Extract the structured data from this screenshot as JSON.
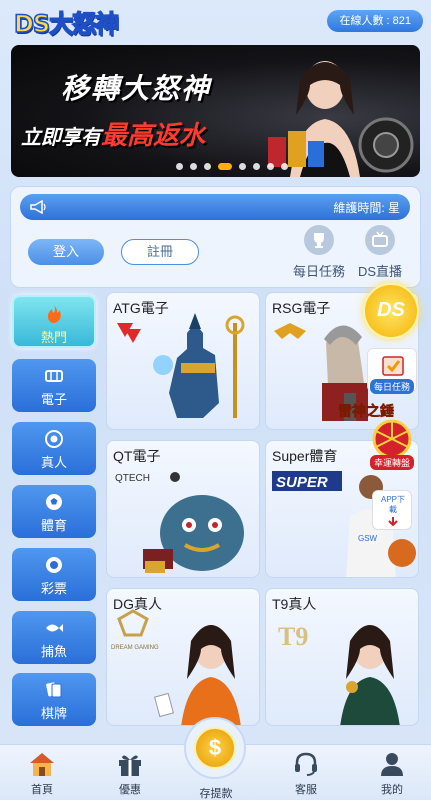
{
  "header": {
    "logo_text": "DS大怒神",
    "online_label": "在線人數 : 821"
  },
  "banner": {
    "line1": "移轉大怒神",
    "line2_prefix": "立即享有",
    "line2_highlight": "最高返水",
    "slide_count": 8,
    "active_slide": 3
  },
  "panel": {
    "marquee_text": "維護時間: 星",
    "login_label": "登入",
    "register_label": "註冊",
    "quick_links": [
      {
        "label": "每日任務",
        "icon": "trophy-icon"
      },
      {
        "label": "DS直播",
        "icon": "tv-icon"
      }
    ]
  },
  "sidebar": {
    "items": [
      {
        "label": "熱門",
        "icon": "fire-icon",
        "active": true
      },
      {
        "label": "電子",
        "icon": "slot-machine-icon",
        "active": false
      },
      {
        "label": "真人",
        "icon": "poker-chip-icon",
        "active": false
      },
      {
        "label": "體育",
        "icon": "soccer-ball-icon",
        "active": false
      },
      {
        "label": "彩票",
        "icon": "lottery-ball-icon",
        "active": false
      },
      {
        "label": "捕魚",
        "icon": "fish-icon",
        "active": false
      },
      {
        "label": "棋牌",
        "icon": "cards-icon",
        "active": false
      }
    ]
  },
  "games": [
    {
      "title": "ATG電子",
      "logo": "ATG"
    },
    {
      "title": "RSG電子",
      "logo": "RSG",
      "art_caption": "雷神之錘"
    },
    {
      "title": "QT電子",
      "logo": "QTECH"
    },
    {
      "title": "Super體育",
      "logo": "SUPER"
    },
    {
      "title": "DG真人",
      "logo": "DREAM GAMING"
    },
    {
      "title": "T9真人",
      "logo": "T9"
    }
  ],
  "floating": {
    "ds_badge": "DS",
    "daily_task": "每日任務",
    "lucky_wheel": "幸運轉盤",
    "app_download": "APP下載"
  },
  "bottom_nav": {
    "items": [
      {
        "label": "首頁",
        "icon": "home-icon"
      },
      {
        "label": "優惠",
        "icon": "gift-icon"
      },
      {
        "label": "存提款",
        "icon": "coin-icon"
      },
      {
        "label": "客服",
        "icon": "headset-icon"
      },
      {
        "label": "我的",
        "icon": "user-icon"
      }
    ],
    "coin_symbol": "$"
  },
  "colors": {
    "primary": "#2f78de",
    "accent": "#ffd84a",
    "active_tab": "#38b8d8",
    "background": "#dce9fb"
  }
}
